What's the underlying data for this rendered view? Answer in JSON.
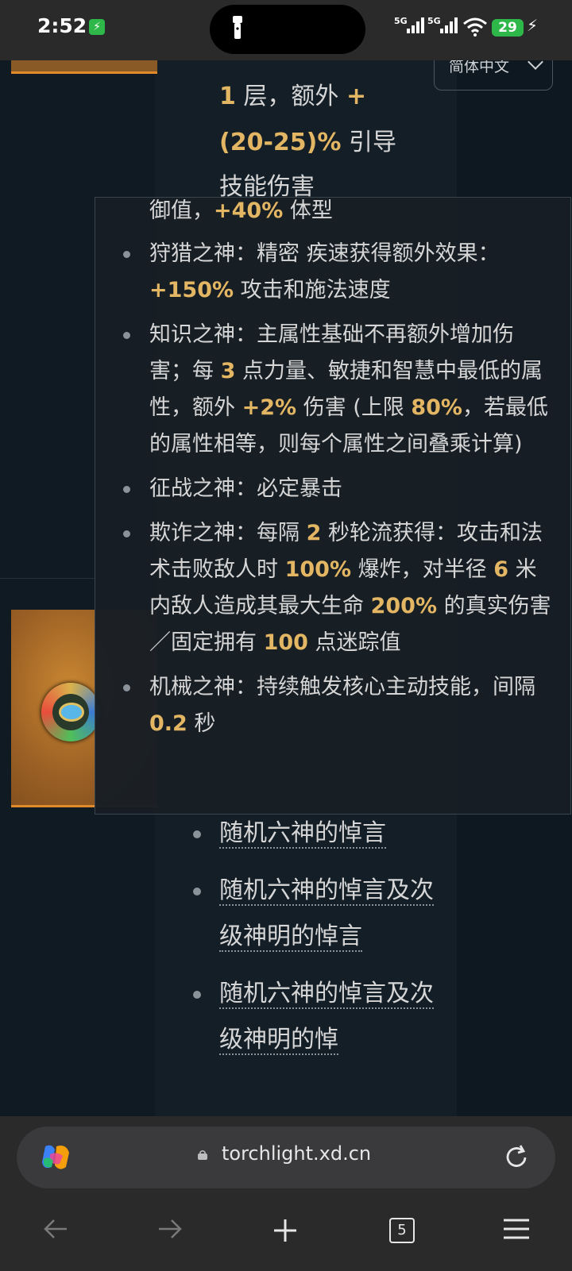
{
  "status_bar": {
    "time": "2:52",
    "signal1": "5G",
    "signal2": "5G",
    "battery": "29"
  },
  "language_selector": {
    "label": "简体中文"
  },
  "background_text": {
    "line1_num": "1",
    "line1_mid": " 层，额外 ",
    "line1_plus": "+",
    "line2_pct": "(20-25)%",
    "line2_rest": " 引导",
    "line3": "技能伤害"
  },
  "tooltip": {
    "fragment_text": "御值，",
    "fragment_value": "+40%",
    "fragment_rest": " 体型",
    "items": [
      {
        "text_a": "狩猎之神：精密 疾速获得额外效果：",
        "value_a": "+150%",
        "text_b": " 攻击和施法速度"
      },
      {
        "text_a": "知识之神：主属性基础不再额外增加伤害；每 ",
        "value_a": "3",
        "text_b": " 点力量、敏捷和智慧中最低的属性，额外 ",
        "value_b": "+2%",
        "text_c": " 伤害 (上限 ",
        "value_c": "80%",
        "text_d": "，若最低的属性相等，则每个属性之间叠乘计算)"
      },
      {
        "text_a": "征战之神：必定暴击"
      },
      {
        "text_a": "欺诈之神：每隔 ",
        "value_a": "2",
        "text_b": " 秒轮流获得：攻击和法术击败敌人时 ",
        "value_b": "100%",
        "text_c": " 爆炸，对半径 ",
        "value_c": "6",
        "text_d": " 米内敌人造成其最大生命 ",
        "value_d": "200%",
        "text_e": " 的真实伤害／固定拥有 ",
        "value_e": "100",
        "text_f": " 点迷踪值"
      },
      {
        "text_a": "机械之神：持续触发核心主动技能，间隔 ",
        "value_a": "0.2",
        "text_b": " 秒"
      }
    ]
  },
  "list": {
    "items": [
      "随机六神的悼言",
      "随机六神的悼言及次级神明的悼言",
      "随机六神的悼言及次级神明的悼"
    ]
  },
  "browser": {
    "url": "torchlight.xd.cn",
    "tab_count": "5"
  }
}
